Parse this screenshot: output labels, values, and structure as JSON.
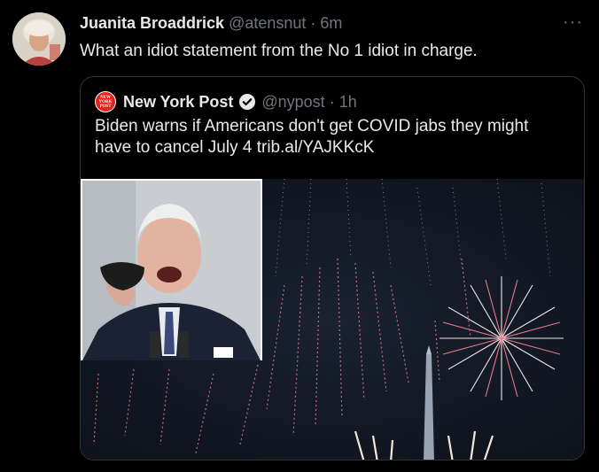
{
  "tweet": {
    "author_name": "Juanita Broaddrick",
    "handle": "@atensnut",
    "separator": "·",
    "time": "6m",
    "more_label": "···",
    "text": "What an idiot statement from the No 1 idiot in charge."
  },
  "quoted": {
    "logo_lines": [
      "NEW",
      "YORK",
      "POST"
    ],
    "author_name": "New York Post",
    "handle": "@nypost",
    "separator": "·",
    "time": "1h",
    "text": "Biden warns if Americans don't get COVID jabs they might have to cancel July 4 trib.al/YAJKKcK"
  },
  "icons": {
    "verified": "verified-badge-icon",
    "more": "more-options-icon"
  },
  "colors": {
    "background": "#000000",
    "text": "#e7e9ea",
    "muted": "#71767b",
    "border": "#2f3336",
    "nyp_red": "#e2231a",
    "firework_pink": "#e8788a"
  }
}
